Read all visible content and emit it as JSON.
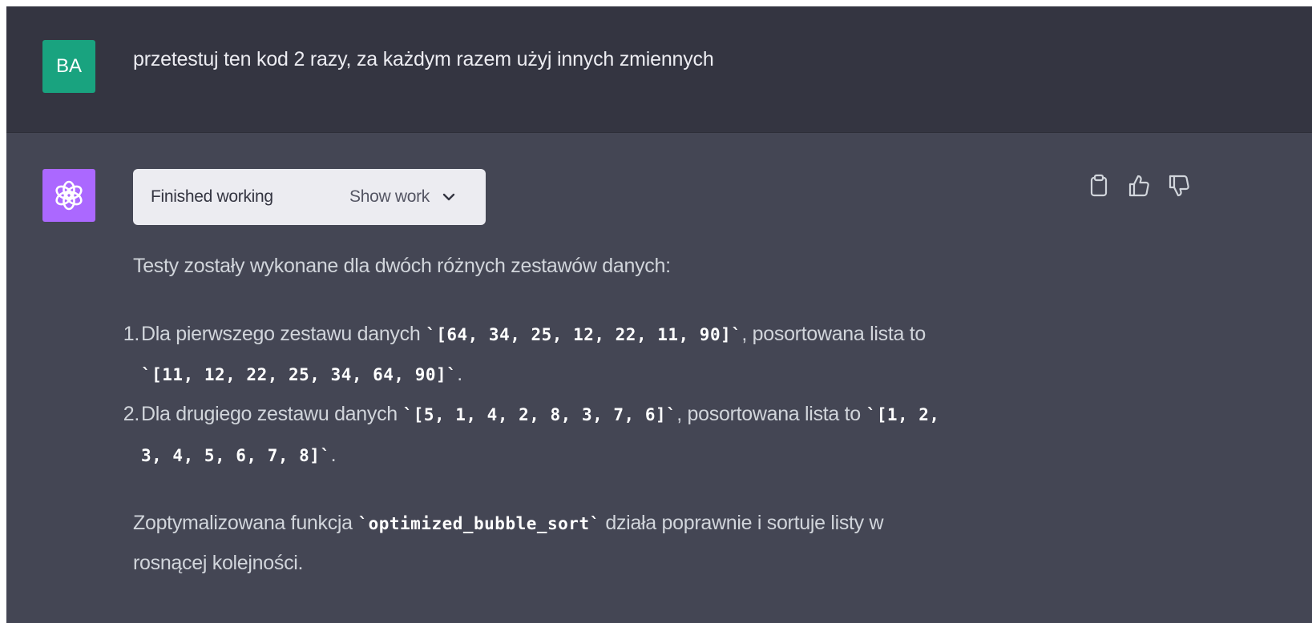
{
  "user": {
    "avatar_initials": "BA",
    "message": "przetestuj ten kod 2 razy, za każdym razem użyj innych zmiennych"
  },
  "assistant": {
    "avatar_icon": "openai-logo-icon",
    "work": {
      "status": "Finished working",
      "toggle_label": "Show work",
      "toggle_icon": "chevron-down-icon"
    },
    "actions": [
      "copy-icon",
      "thumbs-up-icon",
      "thumbs-down-icon"
    ],
    "intro": "Testy zostały wykonane dla dwóch różnych zestawów danych:",
    "list": [
      {
        "number": "1.",
        "text_before": "Dla pierwszego zestawu danych ",
        "input_code": "`[64, 34, 25, 12, 22, 11, 90]`",
        "text_middle": ", posortowana lista to",
        "output_code": "`[11, 12, 22, 25, 34, 64, 90]`",
        "text_after": "."
      },
      {
        "number": "2.",
        "text_before": "Dla drugiego zestawu danych ",
        "input_code": "`[5, 1, 4, 2, 8, 3, 7, 6]`",
        "text_middle": ", posortowana lista to ",
        "output_code_part1": "`[1, 2,",
        "output_code_part2": "3, 4, 5, 6, 7, 8]`",
        "text_after": "."
      }
    ],
    "conclusion": {
      "text_before": "Zoptymalizowana funkcja ",
      "code": "`optimized_bubble_sort`",
      "text_middle": " działa poprawnie i sortuje listy w",
      "text_line2": "rosnącej kolejności."
    }
  },
  "colors": {
    "user_bg": "#343541",
    "assistant_bg": "#444654",
    "user_avatar": "#19a37f",
    "assistant_avatar": "#ab68ff"
  }
}
